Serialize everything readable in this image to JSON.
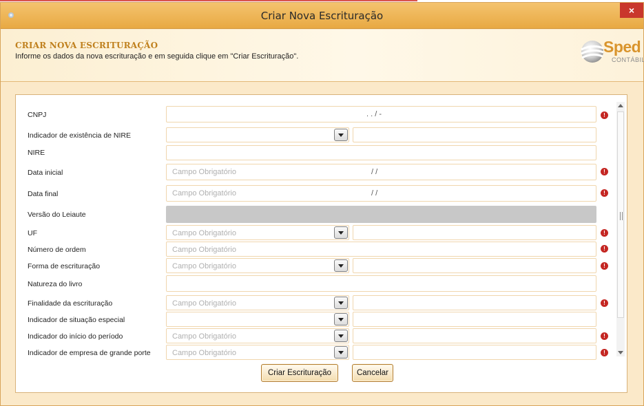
{
  "window": {
    "title": "Criar Nova Escrituração",
    "close_glyph": "×"
  },
  "header": {
    "title": "CRIAR NOVA ESCRITURAÇÃO",
    "subtitle": "Informe os dados da nova escrituração e em seguida clique em \"Criar Escrituração\"."
  },
  "logo": {
    "primary": "Sped",
    "secondary": "CONTÁBIL"
  },
  "icons": {
    "error": "error-badge-icon",
    "dropdown": "chevron-down-icon",
    "window": "app-icon"
  },
  "colors": {
    "error": "#c42622",
    "accent": "#e8a943",
    "header_title": "#c0811f"
  },
  "form": {
    "required_placeholder": "Campo Obrigatório",
    "fields": {
      "cnpj": {
        "label": "CNPJ",
        "mask": ". . /  -"
      },
      "nire_indicator": {
        "label": "Indicador de existência de NIRE"
      },
      "nire": {
        "label": "NIRE"
      },
      "start_date": {
        "label": "Data inicial",
        "placeholder": "Campo Obrigatório",
        "mask": "/ /"
      },
      "end_date": {
        "label": "Data final",
        "placeholder": "Campo Obrigatório",
        "mask": "/ /"
      },
      "layout_version": {
        "label": "Versão do Leiaute"
      },
      "uf": {
        "label": "UF",
        "placeholder": "Campo Obrigatório"
      },
      "order_number": {
        "label": "Número de ordem",
        "placeholder": "Campo Obrigatório"
      },
      "bookkeeping_form": {
        "label": "Forma de escrituração",
        "placeholder": "Campo Obrigatório"
      },
      "book_nature": {
        "label": "Natureza do livro"
      },
      "bookkeeping_purpose": {
        "label": "Finalidade da escrituração",
        "placeholder": "Campo Obrigatório"
      },
      "special_situation": {
        "label": "Indicador de situação especial"
      },
      "period_start": {
        "label": "Indicador do início do período",
        "placeholder": "Campo Obrigatório"
      },
      "large_company": {
        "label": "Indicador de empresa de grande porte",
        "placeholder": "Campo Obrigatório"
      }
    }
  },
  "buttons": {
    "create": "Criar Escrituração",
    "cancel": "Cancelar"
  }
}
